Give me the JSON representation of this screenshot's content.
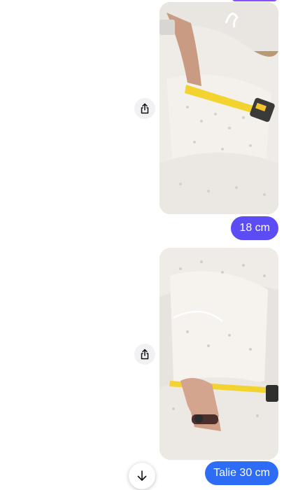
{
  "messages": [
    {
      "type": "image",
      "icon": "photo-dress-waist-measure"
    },
    {
      "type": "text",
      "text": "18 cm"
    },
    {
      "type": "image",
      "icon": "photo-dress-waist-measure-2"
    },
    {
      "type": "text",
      "text": "Talie 30 cm"
    }
  ],
  "icons": {
    "share": "share-icon",
    "scroll_down": "arrow-down-icon"
  },
  "colors": {
    "bubble_purple": "#5b4cf5",
    "bubble_blue": "#2f6cf6"
  }
}
